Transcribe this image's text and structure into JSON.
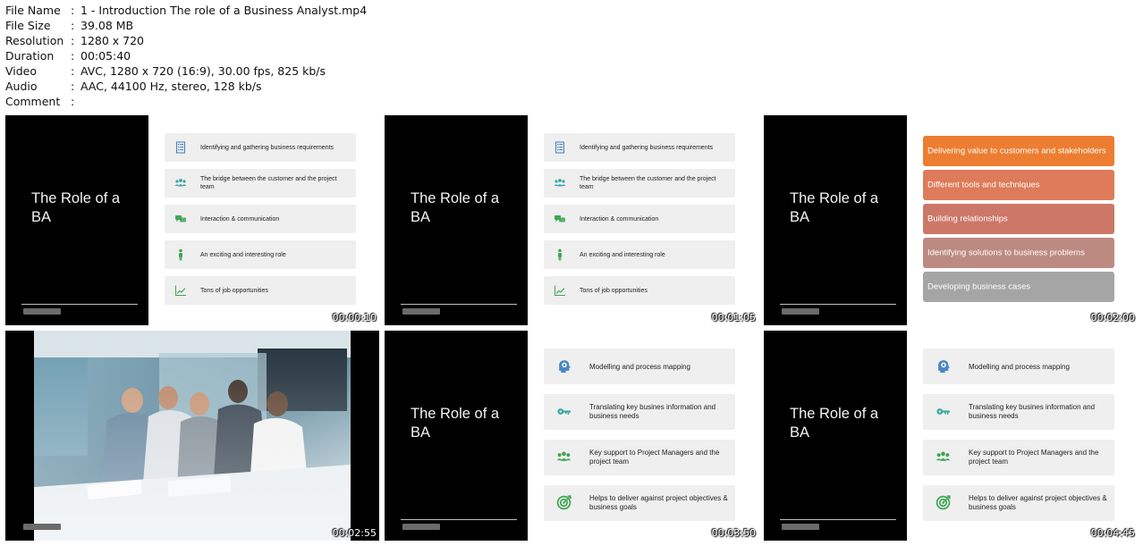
{
  "meta": [
    {
      "key": "File Name",
      "value": "1 - Introduction The role of a Business Analyst.mp4"
    },
    {
      "key": "File Size",
      "value": "39.08 MB"
    },
    {
      "key": "Resolution",
      "value": "1280 x 720"
    },
    {
      "key": "Duration",
      "value": "00:05:40"
    },
    {
      "key": "Video",
      "value": "AVC, 1280 x 720 (16:9), 30.00 fps, 825 kb/s"
    },
    {
      "key": "Audio",
      "value": "AAC, 44100 Hz, stereo, 128 kb/s"
    },
    {
      "key": "Comment",
      "value": ""
    }
  ],
  "separator": ":",
  "slide_title": "The Role of a BA",
  "list_a": [
    {
      "icon": "document-list-icon",
      "text": "Identifying and gathering business requirements"
    },
    {
      "icon": "people-group-icon",
      "text": "The bridge between the customer and the project team"
    },
    {
      "icon": "chat-bubbles-icon",
      "text": "Interaction & communication"
    },
    {
      "icon": "person-icon",
      "text": "An exciting and interesting role"
    },
    {
      "icon": "trend-chart-icon",
      "text": "Tons of job opportunities"
    }
  ],
  "list_b": [
    {
      "text": "Delivering value to customers and stakeholders",
      "color": "#ed7d31"
    },
    {
      "text": "Different tools and techniques",
      "color": "#dd7b5a"
    },
    {
      "text": "Building relationships",
      "color": "#cc7768"
    },
    {
      "text": "Identifying solutions to business problems",
      "color": "#bd8a82"
    },
    {
      "text": "Developing business cases",
      "color": "#a5a5a5"
    }
  ],
  "list_c": [
    {
      "icon": "head-gears-icon",
      "text": "Modelling and process mapping"
    },
    {
      "icon": "key-icon",
      "text": "Translating key busines information and business needs"
    },
    {
      "icon": "people-group-icon",
      "text": "Key support to Project Managers and the project team"
    },
    {
      "icon": "target-icon",
      "text": "Helps to deliver against project objectives & business goals"
    }
  ],
  "timestamps": [
    "00:00:10",
    "00:01:05",
    "00:02:00",
    "00:02:55",
    "00:03:50",
    "00:04:45"
  ],
  "colors": {
    "icon_blue": "#4a86c5",
    "icon_teal": "#3aa8a0",
    "icon_green": "#3fa653"
  }
}
